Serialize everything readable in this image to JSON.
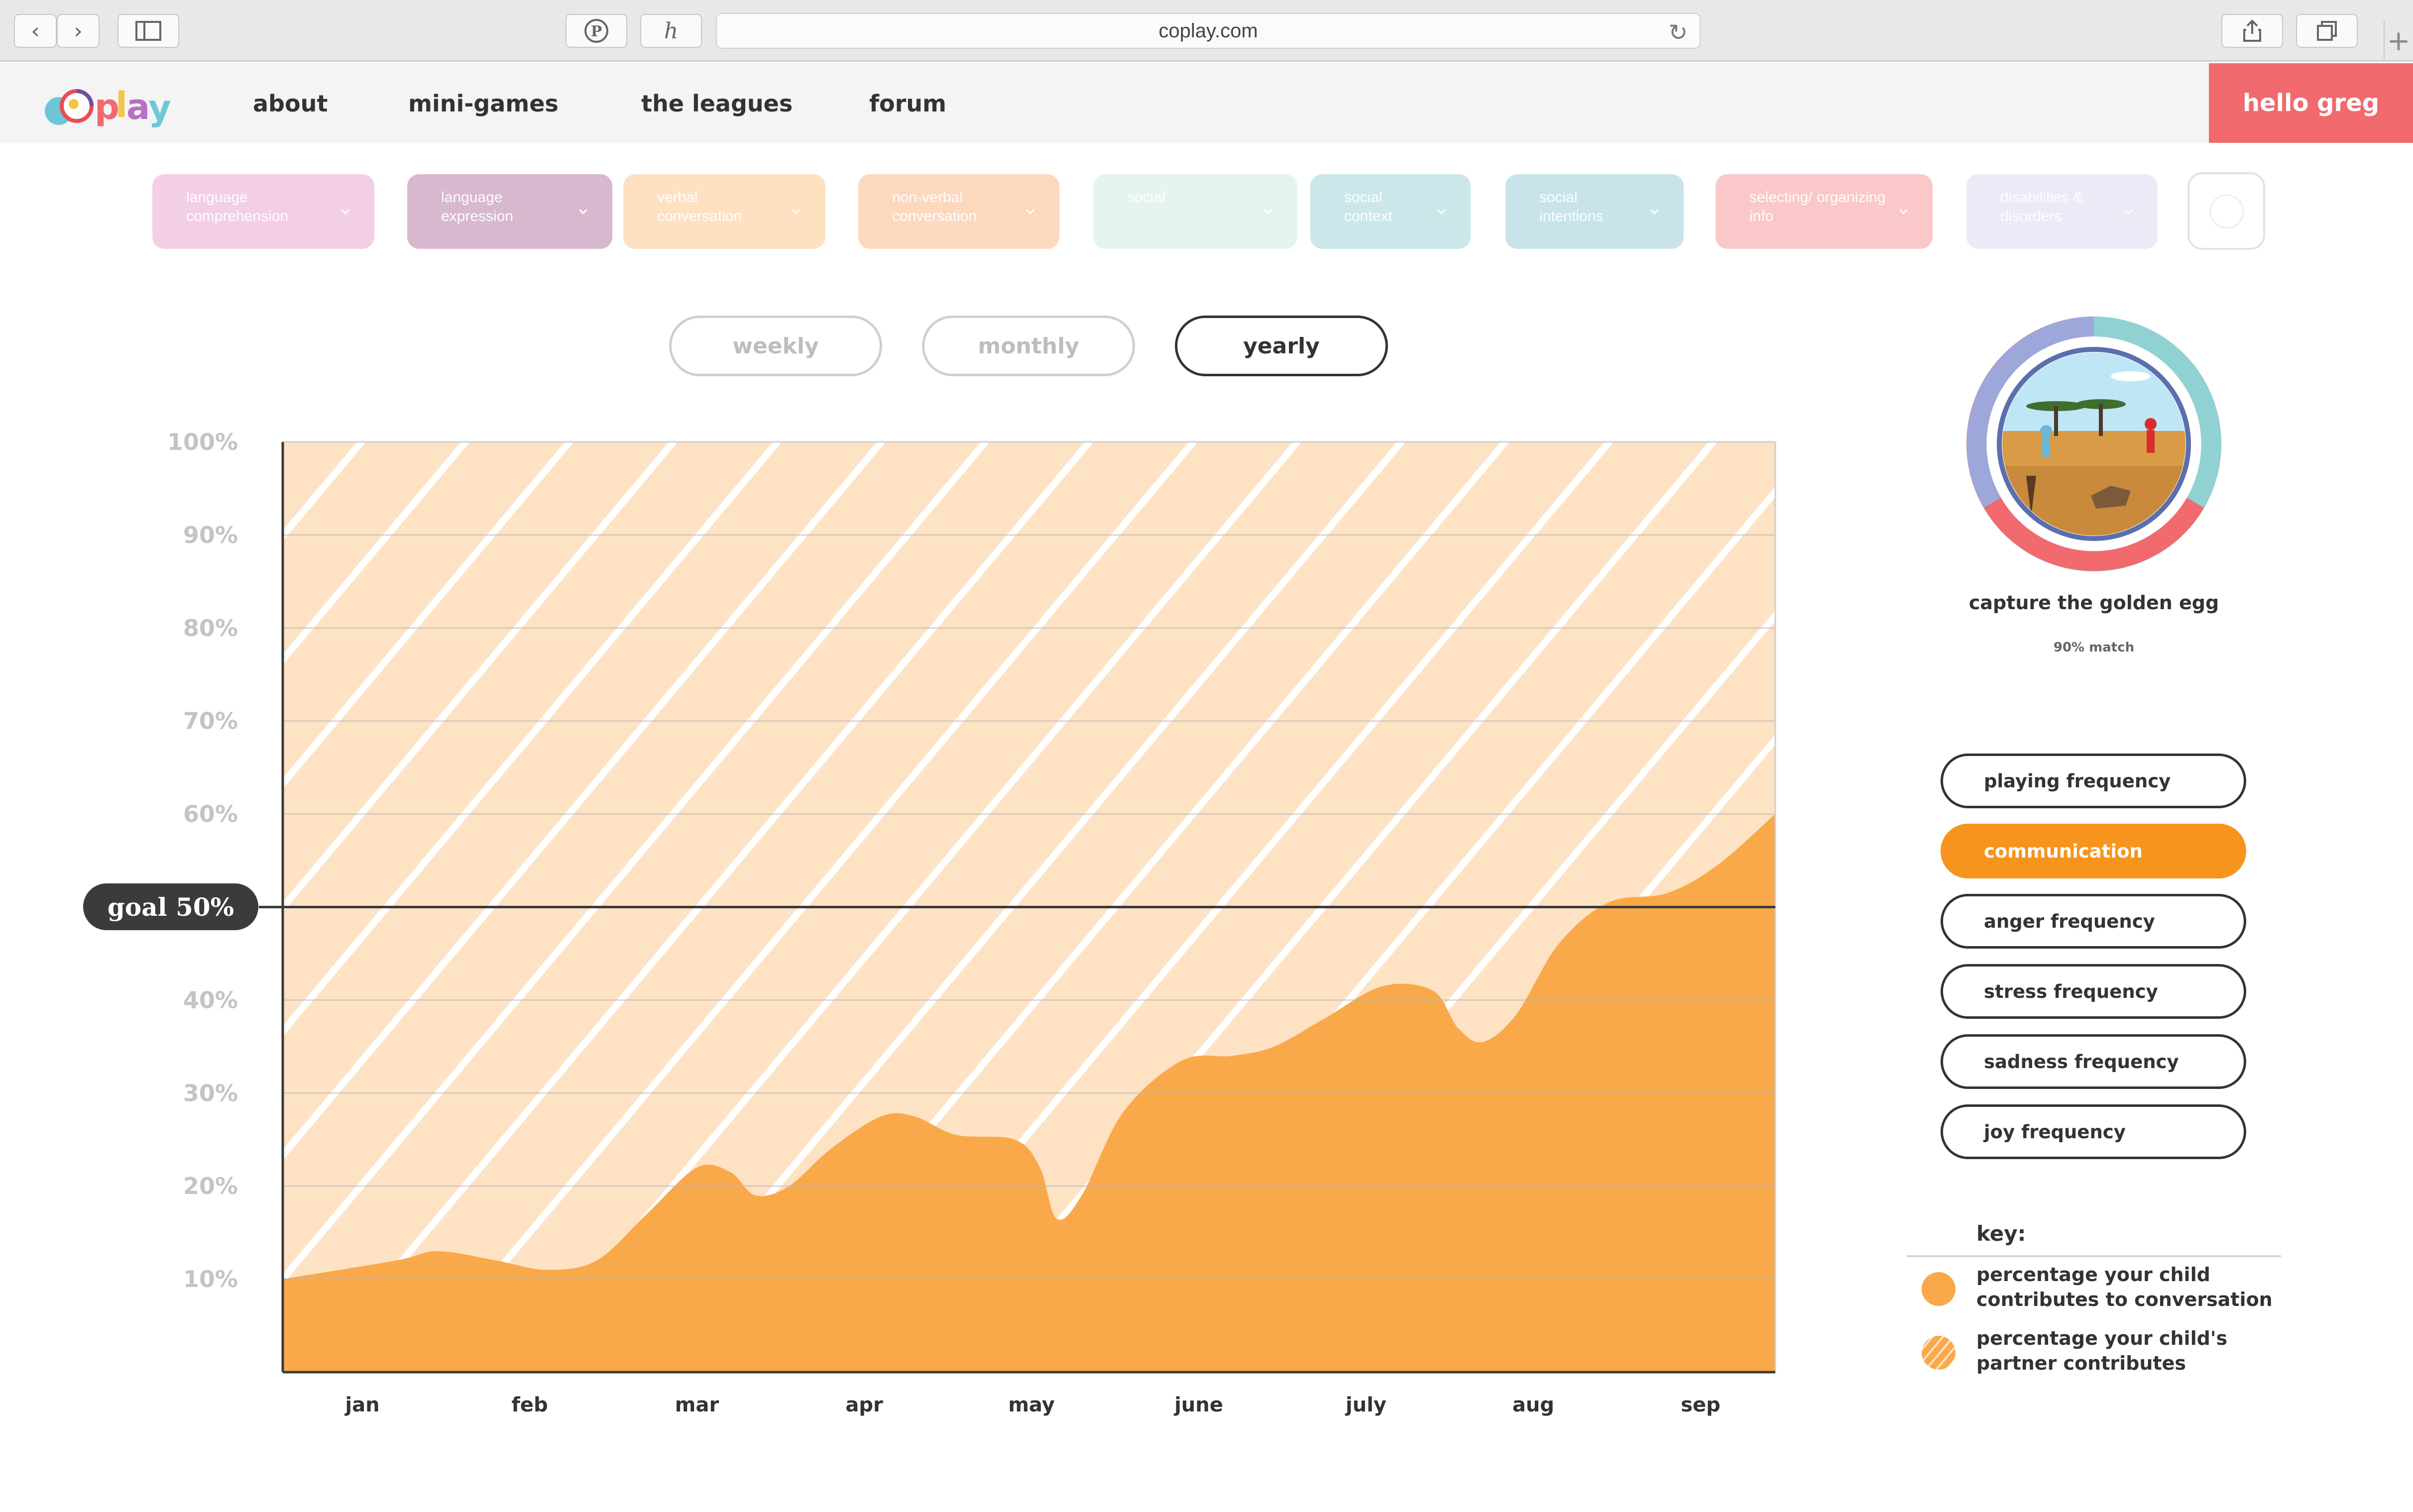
{
  "browser": {
    "url": "coplay.com"
  },
  "nav": {
    "logo": "coplay",
    "links": [
      "about",
      "mini-games",
      "the leagues",
      "forum"
    ],
    "greeting": "hello greg"
  },
  "filters": [
    {
      "label": "language comprehension",
      "color": "#f3cfe6"
    },
    {
      "label": "language expression",
      "color": "#d7b8cf"
    },
    {
      "label": "verbal conversation",
      "color": "#fde1c1"
    },
    {
      "label": "non-verbal conversation",
      "color": "#fcd8bf"
    },
    {
      "label": "social",
      "color": "#e5f4ef"
    },
    {
      "label": "social context",
      "color": "#cbe7ea"
    },
    {
      "label": "social intentions",
      "color": "#c8e4ea"
    },
    {
      "label": "selecting/ organizing info",
      "color": "#fbc8c9"
    },
    {
      "label": "disabilities & disorders",
      "color": "#ebeaf6"
    }
  ],
  "periods": {
    "weekly": "weekly",
    "monthly": "monthly",
    "yearly": "yearly",
    "active": "yearly"
  },
  "goal_label": "goal 50%",
  "chart_data": {
    "type": "area",
    "categories": [
      "jan",
      "feb",
      "mar",
      "apr",
      "may",
      "june",
      "july",
      "aug",
      "sep"
    ],
    "y_ticks": [
      "100%",
      "90%",
      "80%",
      "70%",
      "60%",
      "40%",
      "30%",
      "20%",
      "10%"
    ],
    "ylim": [
      0,
      100
    ],
    "goal": 50,
    "series": [
      {
        "name": "percentage your child contributes to conversation",
        "color": "#f9a949",
        "points": [
          [
            0.0,
            10
          ],
          [
            0.2,
            12
          ],
          [
            0.45,
            13
          ],
          [
            0.8,
            12
          ],
          [
            1.1,
            11
          ],
          [
            1.4,
            12
          ],
          [
            1.7,
            17
          ],
          [
            2.0,
            22
          ],
          [
            2.2,
            21.5
          ],
          [
            2.35,
            19
          ],
          [
            2.55,
            20
          ],
          [
            2.8,
            24
          ],
          [
            3.1,
            27.5
          ],
          [
            3.3,
            27.5
          ],
          [
            3.55,
            25.5
          ],
          [
            3.9,
            25
          ],
          [
            4.05,
            22
          ],
          [
            4.15,
            16.5
          ],
          [
            4.3,
            19
          ],
          [
            4.55,
            28
          ],
          [
            4.9,
            33.5
          ],
          [
            5.2,
            34
          ],
          [
            5.45,
            35
          ],
          [
            5.75,
            38
          ],
          [
            6.1,
            41.5
          ],
          [
            6.4,
            41
          ],
          [
            6.55,
            37
          ],
          [
            6.7,
            35.5
          ],
          [
            6.9,
            38.5
          ],
          [
            7.15,
            46
          ],
          [
            7.45,
            50.5
          ],
          [
            7.8,
            51.5
          ],
          [
            8.1,
            54.5
          ],
          [
            8.45,
            60
          ],
          [
            8.9,
            60
          ]
        ]
      },
      {
        "name": "percentage your child's partner contributes",
        "color": "#fde2c3",
        "values_note": "remainder to 100%"
      }
    ]
  },
  "game": {
    "title": "capture the golden egg",
    "match": "90% match",
    "ring_colors": [
      "#9ea7d9",
      "#8fd2d1",
      "#f06a6e"
    ]
  },
  "metrics": {
    "playing": "playing frequency",
    "communication": "communication",
    "anger": "anger frequency",
    "stress": "stress frequency",
    "sadness": "sadness frequency",
    "joy": "joy frequency",
    "active": "communication"
  },
  "key": {
    "title": "key:",
    "solid": "percentage your child contributes to conversation",
    "striped": "percentage your child's partner contributes"
  },
  "colors": {
    "accent_orange": "#f7941d",
    "hello_red": "#f06a6e"
  }
}
